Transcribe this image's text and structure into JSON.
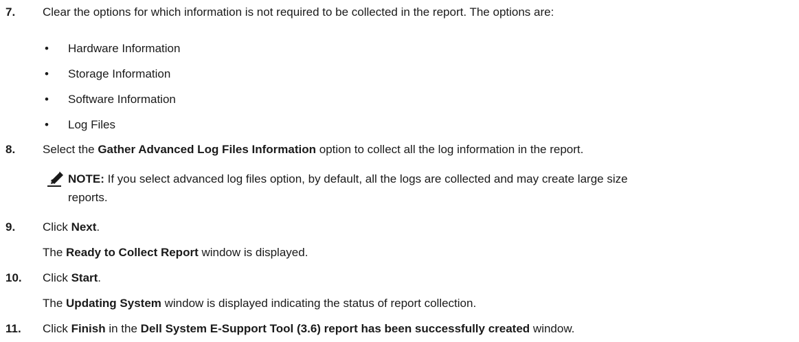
{
  "step7": {
    "number": "7.",
    "text": "Clear the options for which information is not required to be collected in the report. The options are:",
    "bullet_glyph": "•",
    "options": [
      "Hardware Information",
      "Storage Information",
      "Software Information",
      "Log Files"
    ]
  },
  "step8": {
    "number": "8.",
    "text_before": "Select the ",
    "bold": "Gather Advanced Log Files Information",
    "text_after": " option to collect all the log information in the report."
  },
  "note": {
    "icon": "pencil-icon",
    "label": "NOTE:",
    "line1": " If you select advanced log files option, by default, all the logs are collected and may create large size",
    "line2": "reports."
  },
  "step9": {
    "number": "9.",
    "text_before": "Click ",
    "bold": "Next",
    "text_after": ".",
    "result_before": "The ",
    "result_bold": "Ready to Collect Report",
    "result_after": " window is displayed."
  },
  "step10": {
    "number": "10.",
    "text_before": "Click ",
    "bold": "Start",
    "text_after": ".",
    "result_before": "The ",
    "result_bold": "Updating System",
    "result_after": " window is displayed indicating the status of report collection."
  },
  "step11": {
    "number": "11.",
    "text_before": "Click ",
    "bold1": "Finish",
    "text_middle": " in the ",
    "bold2": "Dell System E-Support Tool (3.6) report has been successfully created",
    "text_after": " window."
  }
}
